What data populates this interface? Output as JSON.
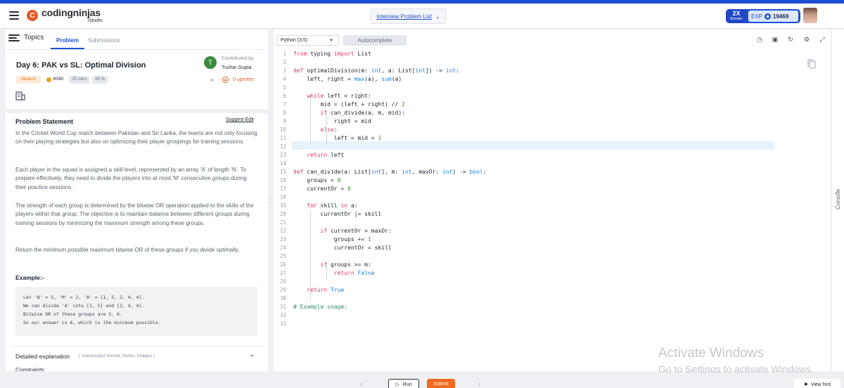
{
  "header": {
    "logo_mark": "C",
    "logo_name": "codingninjas",
    "logo_sub": "/studio",
    "problem_list": "Interview Problem List",
    "booster_multiplier": "2X",
    "booster_word": "Booster",
    "exp_label": "EXP",
    "exp_value": "19469"
  },
  "left": {
    "topics": "Topics",
    "tabs": [
      "Problem",
      "Submissions"
    ],
    "title": "Day 6: PAK vs SL: Optimal Division",
    "contributor_initial": "T",
    "contributed_by": "Contributed by",
    "contributor": "Tushar Gupta",
    "difficulty": "Medium",
    "score": "80/80",
    "time": "25 mins",
    "success": "65 %",
    "upvotes": "0 upvotes",
    "statement_title": "Problem Statement",
    "suggest_edit": "Suggest Edit",
    "paragraphs": [
      "In the Cricket World Cup match between Pakistan and Sri Lanka, the teams are not only focusing on their playing strategies but also on optimizing their player groupings for training sessions.",
      "Each player in the squad is assigned a skill level, represented by an array 'A' of length 'N'. To prepare effectively, they need to divide the players into at most 'M' consecutive groups during their practice sessions.",
      "The strength of each group is determined by the bitwise OR operation applied to the skills of the players within that group. The objective is to maintain balance between different groups during training sessions by minimizing the maximum strength among these groups.",
      "Return the minimum possible maximum bitwise OR of these groups if you divide optimally."
    ],
    "example_title": "Example:-",
    "example_lines": [
      "Let 'N' = 5, 'M' = 2, 'A' = [1, 5, 2, 4, 4].",
      "We can divide 'A' into [1, 5] and [2, 4, 4].",
      "Bitwise OR of these groups are 5, 6.",
      "So our answer is 6, which is the minimum possible."
    ],
    "detailed_title": "Detailed explanation",
    "detailed_sub": "( Input/output format, Notes, Images )",
    "cutoff_text": "Constraints:"
  },
  "editor": {
    "language": "Python (3.5)",
    "autocomplete": "Autocomplete",
    "code_lines": [
      "from typing import List",
      "",
      "def optimalDivision(m: int, a: List[int]) -> int:",
      "    left, right = max(a), sum(a)",
      "",
      "    while left < right:",
      "        mid = (left + right) // 2",
      "        if can_divide(a, m, mid):",
      "            right = mid",
      "        else:",
      "            left = mid + 1",
      "",
      "    return left",
      "",
      "def can_divide(a: List[int], m: int, maxOr: int) -> bool:",
      "    groups = 0",
      "    currentOr = 0",
      "",
      "    for skill in a:",
      "        currentOr |= skill",
      "",
      "        if currentOr > maxOr:",
      "            groups += 1",
      "            currentOr = skill",
      "",
      "        if groups >= m:",
      "            return False",
      "",
      "    return True",
      "",
      "# Example usage:",
      "",
      ""
    ]
  },
  "watermark": {
    "line1": "Activate Windows",
    "line2": "Go to Settings to activate Windows."
  },
  "rail": {
    "console": "Console"
  },
  "bottom": {
    "run": "Run",
    "submit": "Submit",
    "view_hint": "View hint"
  }
}
